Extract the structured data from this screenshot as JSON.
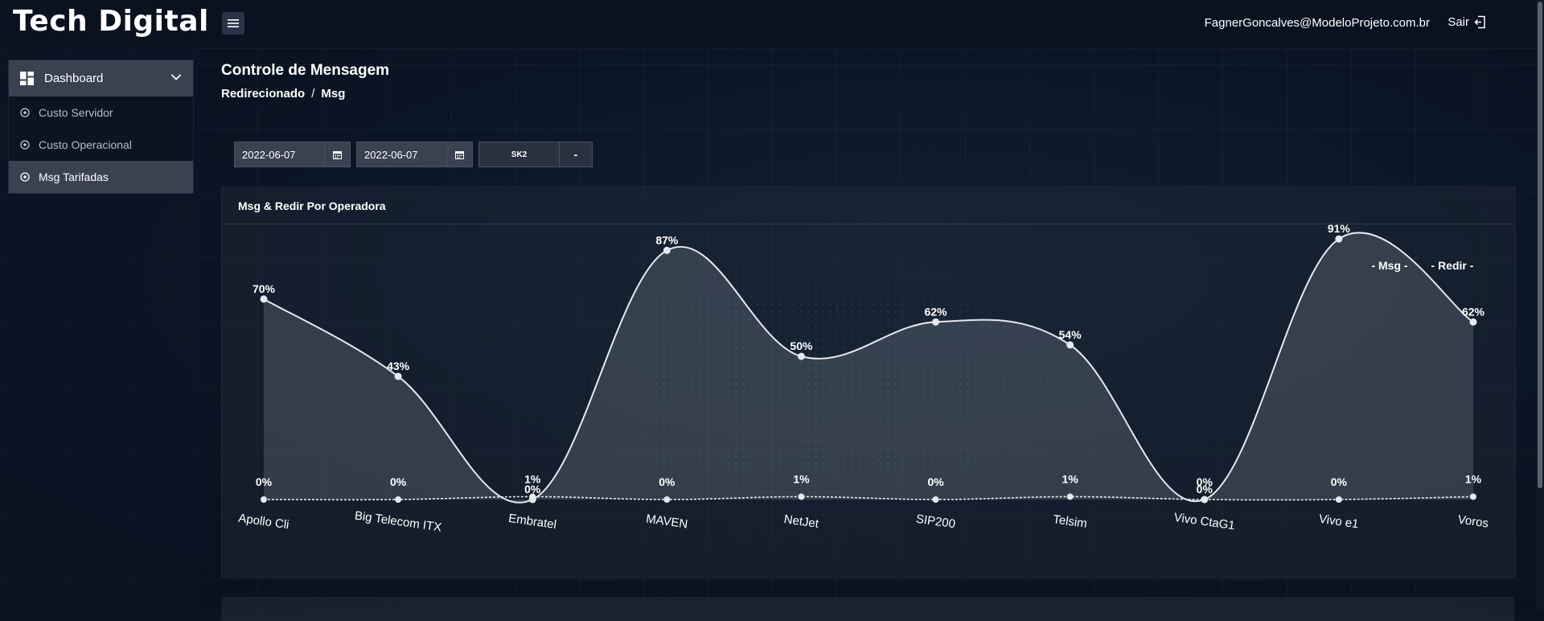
{
  "app": {
    "brand": "Tech Digital",
    "user_email": "FagnerGoncalves@ModeloProjeto.com.br",
    "logout_label": "Sair"
  },
  "sidebar": {
    "header": {
      "label": "Dashboard",
      "icon": "dashboard-icon"
    },
    "items": [
      {
        "label": "Custo Servidor",
        "icon": "circle-dot-icon",
        "active": false
      },
      {
        "label": "Custo Operacional",
        "icon": "circle-dot-icon",
        "active": false
      },
      {
        "label": "Msg Tarifadas",
        "icon": "circle-dot-icon",
        "active": true
      }
    ]
  },
  "main": {
    "title": "Controle de Mensagem",
    "breadcrumb": {
      "first": "Redirecionado",
      "separator": "/",
      "second": "Msg"
    },
    "filters": {
      "date_start": "2022-06-07",
      "date_end": "2022-06-07",
      "select_value": "SK2",
      "select_secondary": "-"
    },
    "card": {
      "title": "Msg & Redir Por Operadora"
    }
  },
  "chart_data": {
    "type": "area",
    "categories": [
      "Apollo Cli",
      "Big Telecom ITX",
      "Embratel",
      "MAVEN",
      "NetJet",
      "SIP200",
      "Telsim",
      "Vivo CtaG1",
      "Vivo e1",
      "Voros"
    ],
    "series": [
      {
        "name": "Msg",
        "values": [
          70,
          43,
          0,
          87,
          50,
          62,
          54,
          0,
          91,
          62
        ],
        "labels": [
          "70%",
          "43%",
          "0%",
          "87%",
          "50%",
          "62%",
          "54%",
          "0%",
          "91%",
          "62%"
        ]
      },
      {
        "name": "Redir",
        "values": [
          0,
          0,
          1,
          0,
          1,
          0,
          1,
          0,
          0,
          1
        ],
        "labels": [
          "0%",
          "0%",
          "1%",
          "0%",
          "1%",
          "0%",
          "1%",
          "0%",
          "0%",
          "1%"
        ]
      }
    ],
    "legend": [
      "- Msg -",
      "- Redir -"
    ],
    "legend_position": "top-right",
    "ylim": [
      0,
      100
    ],
    "grid": false,
    "colors": {
      "line": "#e6e9ee",
      "fill": "#c8cdd6"
    }
  }
}
